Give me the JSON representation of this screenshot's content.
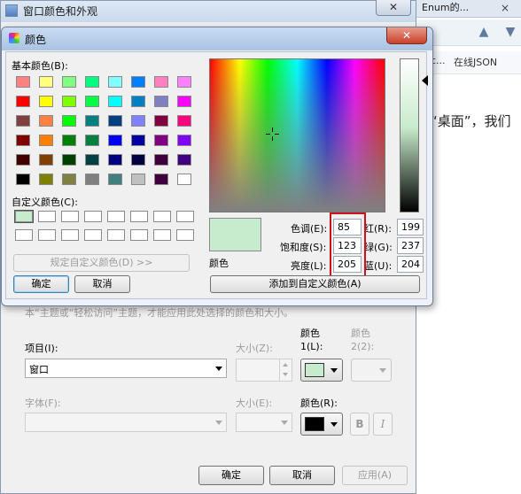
{
  "background_browser": {
    "tab_label": "Enum的...",
    "tab_close": "×",
    "nav_text_1": "c...",
    "nav_text_2": "在线JSON",
    "body_text": "“桌面”，我们",
    "bar_buttons": [
      "▲",
      "▼"
    ]
  },
  "appearance_window": {
    "title": "窗口颜色和外观",
    "close": "✕",
    "hint_text": "本“主题或“轻松访问”主题，才能应用此处选择的颜色和大小。",
    "item_label": "项目(I):",
    "item_value": "窗口",
    "size1_label": "大小(Z):",
    "color1_label_a": "颜色",
    "color1_label_b": "1(L):",
    "color1_value": "#c7ebcd",
    "color2_label_a": "颜色",
    "color2_label_b": "2(2):",
    "font_label": "字体(F):",
    "size2_label": "大小(E):",
    "font_color_label": "颜色(R):",
    "font_color_value": "#000000",
    "bold_label": "B",
    "italic_label": "I",
    "ok": "确定",
    "cancel": "取消",
    "apply": "应用(A)"
  },
  "color_dialog": {
    "title": "颜色",
    "close": "✕",
    "basic_colors_label": "基本颜色(B):",
    "basic_colors": [
      [
        "#ff8080",
        "#ffff80",
        "#80ff80",
        "#00ff80",
        "#80ffff",
        "#0080ff",
        "#ff80c0",
        "#ff80ff"
      ],
      [
        "#ff0000",
        "#ffff00",
        "#80ff00",
        "#00ff40",
        "#00ffff",
        "#0080c0",
        "#8080c0",
        "#ff00ff"
      ],
      [
        "#804040",
        "#ff8040",
        "#00ff00",
        "#008080",
        "#004080",
        "#8080ff",
        "#800040",
        "#ff0080"
      ],
      [
        "#800000",
        "#ff8000",
        "#008000",
        "#008040",
        "#0000ff",
        "#0000a0",
        "#800080",
        "#8000ff"
      ],
      [
        "#400000",
        "#804000",
        "#004000",
        "#004040",
        "#000080",
        "#000040",
        "#400040",
        "#400080"
      ],
      [
        "#000000",
        "#808000",
        "#808040",
        "#808080",
        "#408080",
        "#c0c0c0",
        "#400040",
        "#ffffff"
      ]
    ],
    "custom_colors_label": "自定义颜色(C):",
    "custom_colors": [
      [
        "#c7ebcd",
        "#ffffff",
        "#ffffff",
        "#ffffff",
        "#ffffff",
        "#ffffff",
        "#ffffff",
        "#ffffff"
      ],
      [
        "#ffffff",
        "#ffffff",
        "#ffffff",
        "#ffffff",
        "#ffffff",
        "#ffffff",
        "#ffffff",
        "#ffffff"
      ]
    ],
    "define_custom_button": "规定自定义颜色(D) >>",
    "ok": "确定",
    "cancel": "取消",
    "preview_label": "颜色",
    "preview_color": "#c7ebcd",
    "hue_label": "色调(E):",
    "hue": "85",
    "sat_label": "饱和度(S):",
    "sat": "123",
    "lum_label": "亮度(L):",
    "lum": "205",
    "red_label": "红(R):",
    "red": "199",
    "green_label": "绿(G):",
    "green": "237",
    "blue_label": "蓝(U):",
    "blue": "204",
    "add_custom_button": "添加到自定义颜色(A)"
  }
}
